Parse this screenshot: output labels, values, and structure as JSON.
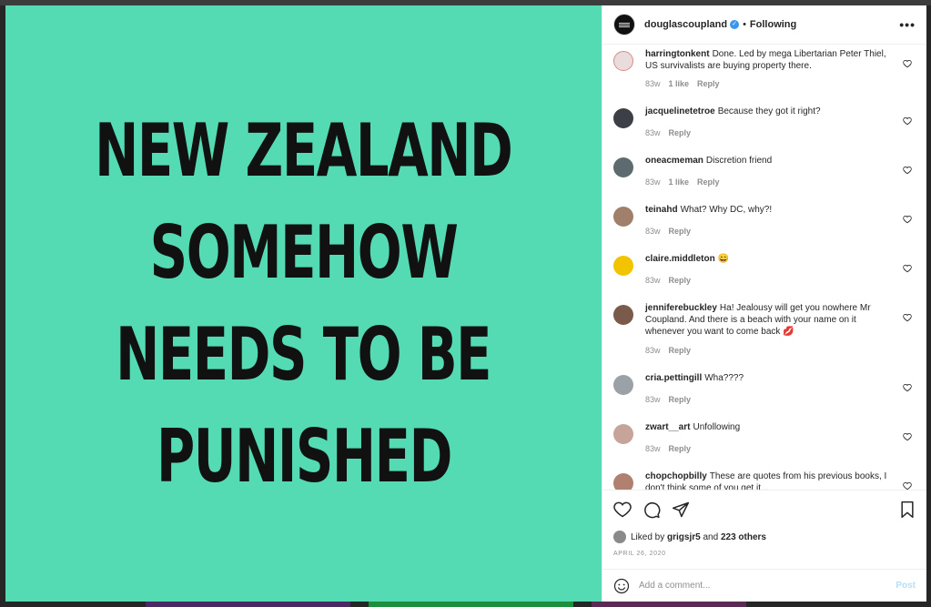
{
  "post": {
    "lines": [
      "NEW ZEALAND",
      "SOMEHOW",
      "NEEDS TO BE",
      "PUNISHED"
    ],
    "background_color": "#54dbb4"
  },
  "header": {
    "username": "douglascoupland",
    "separator": "•",
    "follow_status": "Following",
    "more_icon": "more-horizontal-icon"
  },
  "comments": [
    {
      "username": "harringtonkent",
      "text": "Done. Led by mega Libertarian Peter Thiel, US survivalists are buying property there.",
      "time": "83w",
      "likes": "1 like",
      "reply": "Reply",
      "avatar_color": "#e8dcdc"
    },
    {
      "username": "jacquelinetetroe",
      "text": "Because they got it right?",
      "time": "83w",
      "likes": "",
      "reply": "Reply",
      "avatar_color": "#3c4046"
    },
    {
      "username": "oneacmeman",
      "text": "Discretion friend",
      "time": "83w",
      "likes": "1 like",
      "reply": "Reply",
      "avatar_color": "#5d6b70"
    },
    {
      "username": "teinahd",
      "text": "What? Why DC, why?!",
      "time": "83w",
      "likes": "",
      "reply": "Reply",
      "avatar_color": "#a0806a"
    },
    {
      "username": "claire.middleton",
      "text": "😄",
      "time": "83w",
      "likes": "",
      "reply": "Reply",
      "avatar_color": "#f2c400"
    },
    {
      "username": "jenniferebuckley",
      "text": "Ha! Jealousy will get you nowhere Mr Coupland. And there is a beach with your name on it whenever you want to come back 💋",
      "time": "83w",
      "likes": "",
      "reply": "Reply",
      "avatar_color": "#7a5a4a"
    },
    {
      "username": "cria.pettingill",
      "text": "Wha????",
      "time": "83w",
      "likes": "",
      "reply": "Reply",
      "avatar_color": "#9aa2a8"
    },
    {
      "username": "zwart__art",
      "text": "Unfollowing",
      "time": "83w",
      "likes": "",
      "reply": "Reply",
      "avatar_color": "#c7a49a"
    },
    {
      "username": "chopchopbilly",
      "text": "These are quotes from his previous books, I don't think some of you get it...",
      "time": "",
      "likes": "",
      "reply": "",
      "avatar_color": "#b08070"
    }
  ],
  "engagement": {
    "liked_prefix": "Liked by",
    "liked_user": "grigsjr5",
    "liked_and": "and",
    "liked_others": "223 others",
    "date": "APRIL 26, 2020"
  },
  "composer": {
    "placeholder": "Add a comment...",
    "post_label": "Post"
  },
  "colors": {
    "verified": "#3897f0",
    "post_button_disabled": "#b2dffc"
  }
}
